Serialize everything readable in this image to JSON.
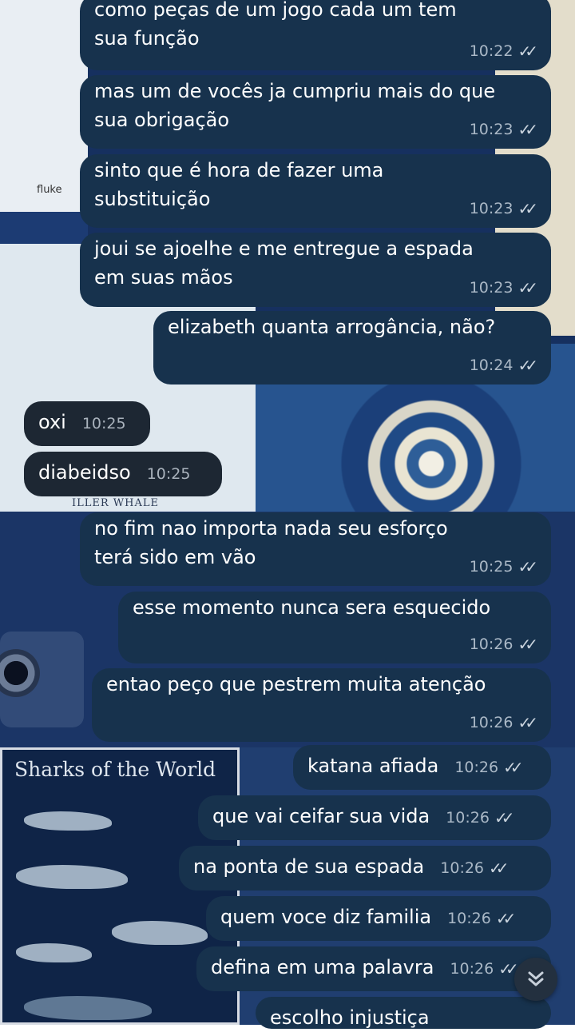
{
  "wallpaper": {
    "fluke_label": "fluke",
    "whale_label": "ILLER WHALE",
    "sharks_title": "Sharks of the World"
  },
  "messages": [
    {
      "text": "como peças de um jogo cada um tem\nsua função",
      "time": "10:22",
      "ticks": "✓✓"
    },
    {
      "text": "mas um de vocês ja cumpriu mais do que\nsua obrigação",
      "time": "10:23",
      "ticks": "✓✓"
    },
    {
      "text": "sinto que é hora de fazer uma\nsubstituição",
      "time": "10:23",
      "ticks": "✓✓"
    },
    {
      "text": "joui se ajoelhe e me entregue a espada\nem suas mãos",
      "time": "10:23",
      "ticks": "✓✓"
    },
    {
      "text": "elizabeth quanta arrogância, não?",
      "time": "10:24",
      "ticks": "✓✓"
    },
    {
      "text": "oxi",
      "time": "10:25"
    },
    {
      "text": "diabeidso",
      "time": "10:25"
    },
    {
      "text": "no fim nao importa nada seu esforço\nterá sido em vão",
      "time": "10:25",
      "ticks": "✓✓"
    },
    {
      "text": "esse momento nunca sera esquecido",
      "time": "10:26",
      "ticks": "✓✓"
    },
    {
      "text": "entao peço que pestrem muita atenção",
      "time": "10:26",
      "ticks": "✓✓"
    },
    {
      "text": "katana afiada",
      "time": "10:26",
      "ticks": "✓✓"
    },
    {
      "text": "que vai ceifar sua vida",
      "time": "10:26",
      "ticks": "✓✓"
    },
    {
      "text": "na ponta de sua espada",
      "time": "10:26",
      "ticks": "✓✓"
    },
    {
      "text": "quem voce diz familia",
      "time": "10:26",
      "ticks": "✓✓"
    },
    {
      "text": "defina em uma palavra",
      "time": "10:26",
      "ticks": "✓✓"
    },
    {
      "text": "escolho injustiça",
      "time": "",
      "ticks": ""
    }
  ],
  "scroll_button": {
    "icon": "double-chevron-down-icon"
  }
}
